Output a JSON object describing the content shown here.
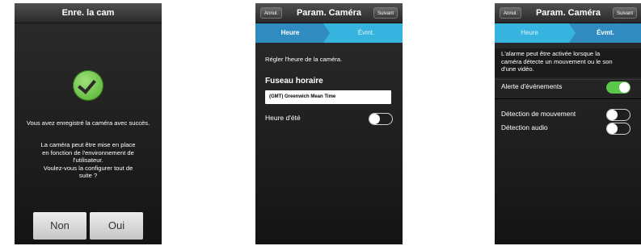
{
  "screen1": {
    "title": "Enre. la cam",
    "success_message": "Vous avez enregistré la caméra avec succès.",
    "info_lines": [
      "La caméra peut être mise en place",
      "en fonction de l'environnement de",
      "l'utilisateur.",
      "Voulez-vous la configurer tout de",
      "suite ?"
    ],
    "no_label": "Non",
    "yes_label": "Oui",
    "success_icon": "check-circle-icon"
  },
  "screen2": {
    "cancel_label": "Annul.",
    "title": "Param. Caméra",
    "next_label": "Suivant",
    "step_active": "Heure",
    "step_next": "Évmt.",
    "instruction": "Régler l'heure de la caméra.",
    "timezone_heading": "Fuseau horaire",
    "timezone_value": "(GMT) Greenwich Mean Time",
    "dst_label": "Heure d'été",
    "dst_on": false
  },
  "screen3": {
    "cancel_label": "Annul.",
    "title": "Param. Caméra",
    "next_label": "Suivant",
    "step_prev": "Heure",
    "step_active": "Évmt.",
    "description_lines": [
      "L'alarme peut être activée lorsque la",
      "caméra détecte un mouvement ou le son",
      "d'une vidéo."
    ],
    "event_alert_label": "Alerte d'événements",
    "event_alert_on": true,
    "motion_label": "Détection de mouvement",
    "motion_on": false,
    "audio_label": "Détection audio",
    "audio_on": false
  },
  "colors": {
    "step_active": "#2f8bc0",
    "step_inactive": "#36b3df",
    "toggle_on": "#5ac84a",
    "success_green": "#5cb82f"
  }
}
